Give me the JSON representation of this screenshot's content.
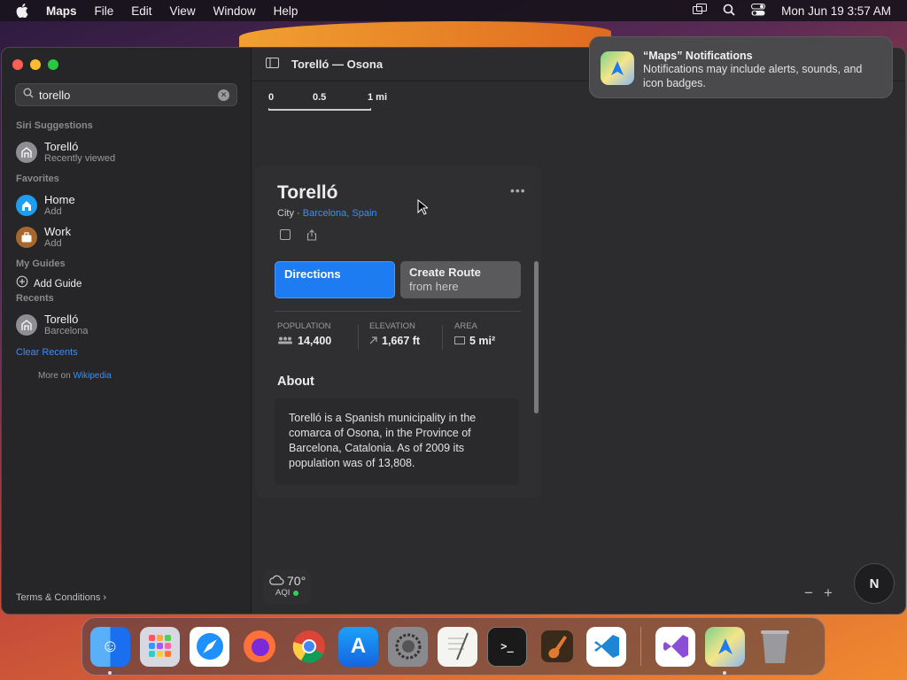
{
  "menubar": {
    "app_name": "Maps",
    "menus": [
      "File",
      "Edit",
      "View",
      "Window",
      "Help"
    ],
    "clock": "Mon Jun 19  3:57 AM"
  },
  "sidebar": {
    "search_value": "torello",
    "siri_title": "Siri Suggestions",
    "siri_item": {
      "title": "Torelló",
      "subtitle": "Recently viewed"
    },
    "favorites_title": "Favorites",
    "home": {
      "title": "Home",
      "subtitle": "Add"
    },
    "work": {
      "title": "Work",
      "subtitle": "Add"
    },
    "guides_title": "My Guides",
    "add_guide": "Add Guide",
    "recents_title": "Recents",
    "recent_item": {
      "title": "Torelló",
      "subtitle": "Barcelona"
    },
    "clear_recents": "Clear Recents",
    "terms": "Terms & Conditions ›"
  },
  "main": {
    "window_title": "Torelló — Osona",
    "scale": [
      "0",
      "0.5",
      "1 mi"
    ],
    "card": {
      "name": "Torelló",
      "type": "City · ",
      "location": "Barcelona, Spain",
      "directions": "Directions",
      "route_title": "Create Route",
      "route_sub": "from here",
      "stats": [
        {
          "label": "POPULATION",
          "value": "14,400"
        },
        {
          "label": "ELEVATION",
          "value": "1,667 ft"
        },
        {
          "label": "AREA",
          "value": "5 mi²"
        }
      ],
      "about_title": "About",
      "about_text": "Torelló is a Spanish municipality in the comarca of Osona, in the Province of Barcelona, Catalonia. As of 2009 its population was of 13,808.",
      "more_on": "More on ",
      "wikipedia": "Wikipedia"
    },
    "weather": {
      "temp": "70°",
      "aqi": "AQI"
    },
    "compass": "N",
    "zoom_out": "−",
    "zoom_in": "+"
  },
  "notification": {
    "title": "“Maps” Notifications",
    "body": "Notifications may include alerts, sounds, and icon badges."
  },
  "colors": {
    "accent": "#1e7cf2",
    "link": "#3a8ef6"
  }
}
